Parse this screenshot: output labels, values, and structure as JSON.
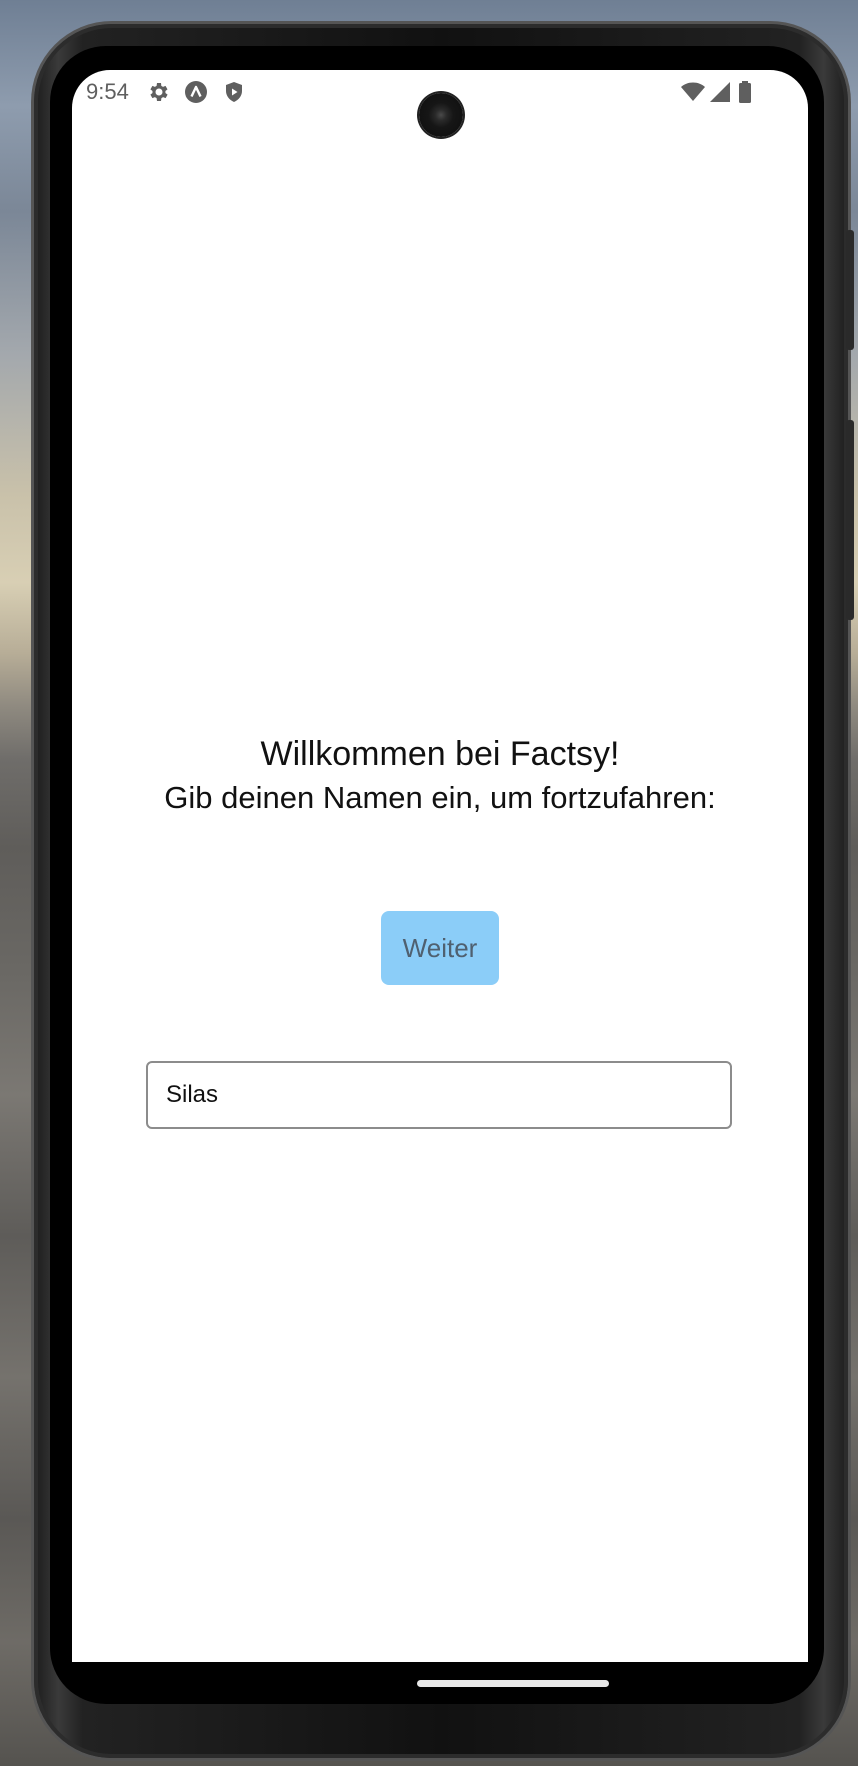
{
  "status_bar": {
    "time": "9:54",
    "left_icons": [
      "settings-icon",
      "android-a-icon",
      "shield-play-icon"
    ],
    "right_icons": [
      "wifi-icon",
      "cell-signal-icon",
      "battery-icon"
    ]
  },
  "welcome": {
    "title": "Willkommen bei Factsy!",
    "subtitle": "Gib deinen Namen ein, um fortzufahren:"
  },
  "continue_button": {
    "label": "Weiter",
    "color": "#8bcdf8"
  },
  "name_input": {
    "value": "Silas"
  }
}
